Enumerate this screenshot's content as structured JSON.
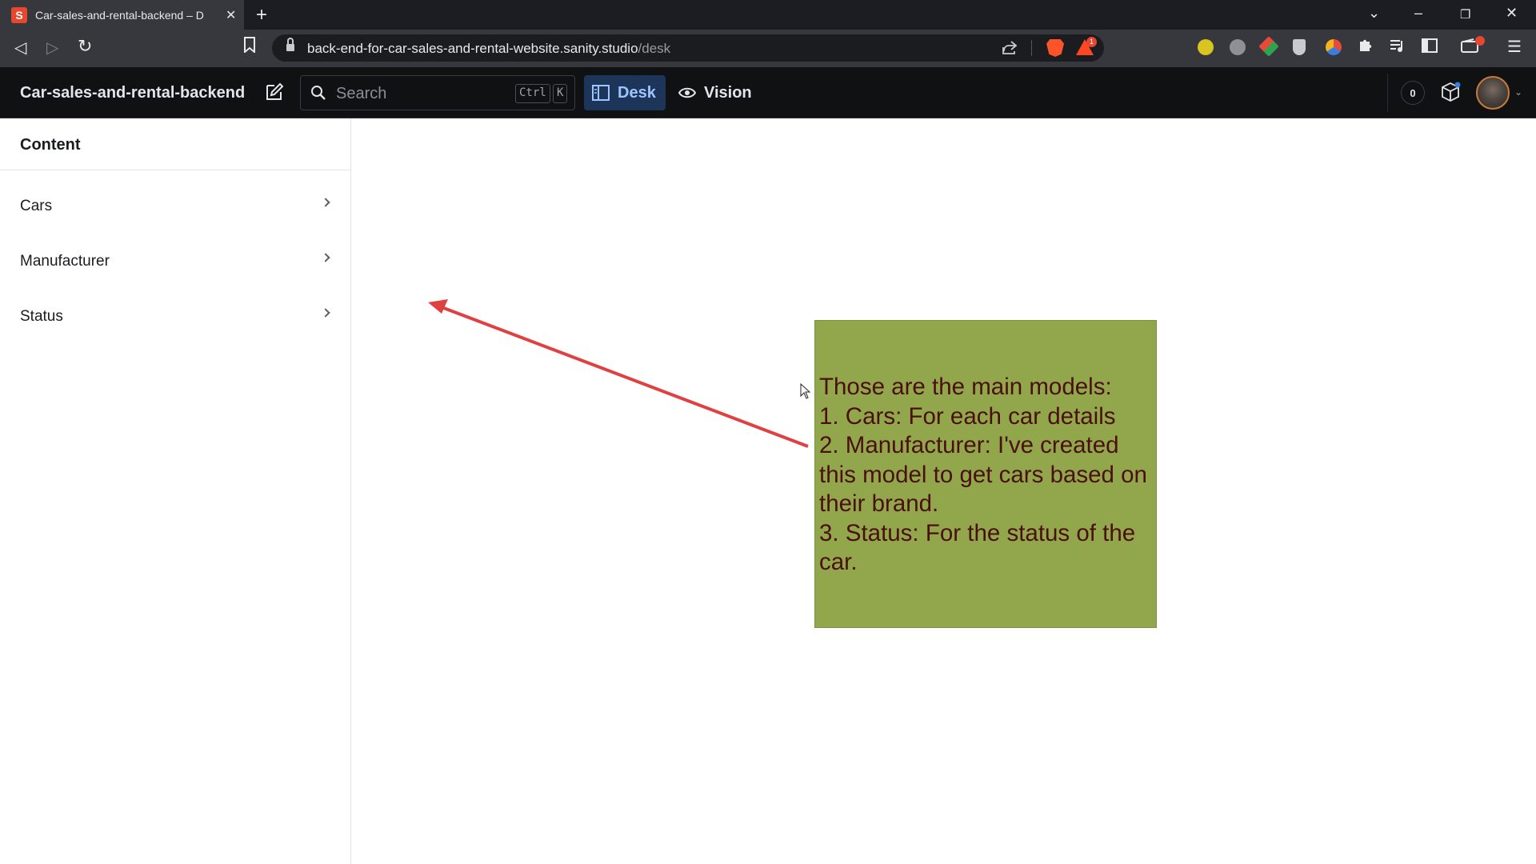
{
  "browser": {
    "tab_title": "Car-sales-and-rental-backend – D",
    "tab_favicon_letter": "S",
    "url_host": "back-end-for-car-sales-and-rental-website.sanity.studio",
    "url_path": "/desk",
    "rewards_badge": "1"
  },
  "studio": {
    "title": "Car-sales-and-rental-backend",
    "search_placeholder": "Search",
    "search_kbd_1": "Ctrl",
    "search_kbd_2": "K",
    "tabs": [
      {
        "label": "Desk",
        "active": true
      },
      {
        "label": "Vision",
        "active": false
      }
    ],
    "notification_count": "0"
  },
  "pane": {
    "title": "Content",
    "items": [
      {
        "label": "Cars"
      },
      {
        "label": "Manufacturer"
      },
      {
        "label": "Status"
      }
    ]
  },
  "annotation": {
    "text": "Those are the main models:\n1. Cars: For each car details\n2. Manufacturer: I've created this model to get cars based on their brand.\n3. Status: For the status of the car.",
    "background_color": "#92a74c",
    "text_color": "#4a0f0f",
    "arrow_color": "#e04040"
  },
  "colors": {
    "appbar_bg": "#101112",
    "active_tab_bg": "#1c3559",
    "active_tab_fg": "#9ec5ff"
  }
}
